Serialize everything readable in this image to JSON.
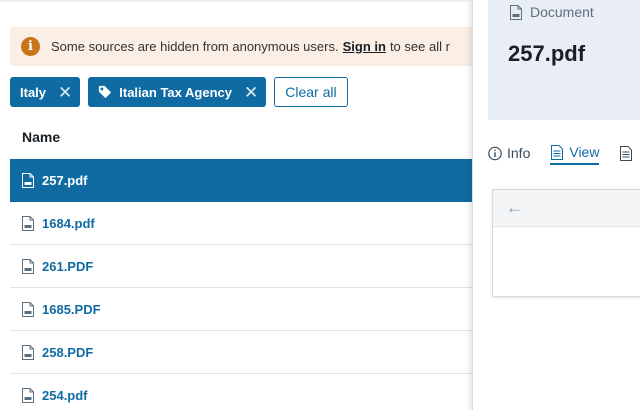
{
  "notice": {
    "icon": "info-icon",
    "text_before": "Some sources are hidden from anonymous users.",
    "link": "Sign in",
    "text_after": "to see all r"
  },
  "filters": [
    {
      "label": "Italy",
      "icon": null
    },
    {
      "label": "Italian Tax Agency",
      "icon": "tag-icon"
    }
  ],
  "clear_all_label": "Clear all",
  "table": {
    "column_name": "Name",
    "rows": [
      {
        "name": "257.pdf",
        "selected": true
      },
      {
        "name": "1684.pdf",
        "selected": false
      },
      {
        "name": "261.PDF",
        "selected": false
      },
      {
        "name": "1685.PDF",
        "selected": false
      },
      {
        "name": "258.PDF",
        "selected": false
      },
      {
        "name": "254.pdf",
        "selected": false
      }
    ]
  },
  "preview": {
    "kind_label": "Document",
    "title": "257.pdf",
    "tabs": [
      {
        "label": "Info",
        "icon": "info-circle-icon",
        "active": false
      },
      {
        "label": "View",
        "icon": "document-icon",
        "active": true
      },
      {
        "label": "",
        "icon": "document-icon",
        "active": false
      }
    ],
    "viewer_back_icon": "arrow-left-icon"
  },
  "colors": {
    "accent": "#106ba3",
    "notice_bg": "#fbeee4",
    "warning": "#c87619",
    "preview_header_bg": "#e8eef4"
  }
}
